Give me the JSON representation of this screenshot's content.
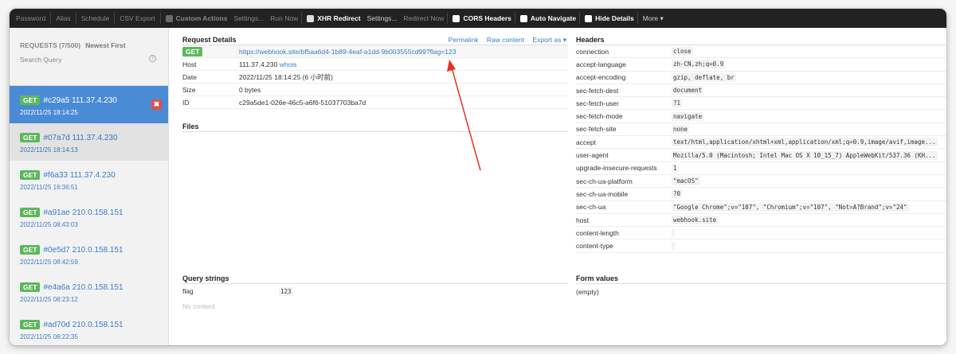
{
  "toolbar": {
    "password": "Password",
    "alias": "Alias",
    "schedule": "Schedule",
    "csv_export": "CSV Export",
    "custom_actions": "Custom Actions",
    "custom_settings": "Settings...",
    "run_now": "Run Now",
    "xhr_redirect": "XHR Redirect",
    "xhr_settings": "Settings...",
    "redirect_now": "Redirect Now",
    "cors_headers": "CORS Headers",
    "auto_navigate": "Auto Navigate",
    "hide_details": "Hide Details",
    "more": "More ▾"
  },
  "sidebar": {
    "requests_label": "REQUESTS (7/500)",
    "sort_label": "Newest First",
    "search_placeholder": "Search Query",
    "items": [
      {
        "method": "GET",
        "id": "#c29a5",
        "ip": "111.37.4.230",
        "date": "2022/11/25 18:14:25"
      },
      {
        "method": "GET",
        "id": "#07a7d",
        "ip": "111.37.4.230",
        "date": "2022/11/25 18:14:13"
      },
      {
        "method": "GET",
        "id": "#f6a33",
        "ip": "111.37.4.230",
        "date": "2022/11/25 16:36:51"
      },
      {
        "method": "GET",
        "id": "#a91ae",
        "ip": "210.0.158.151",
        "date": "2022/11/25 08:43:03"
      },
      {
        "method": "GET",
        "id": "#0e5d7",
        "ip": "210.0.158.151",
        "date": "2022/11/25 08:42:59"
      },
      {
        "method": "GET",
        "id": "#e4a6a",
        "ip": "210.0.158.151",
        "date": "2022/11/25 08:23:12"
      },
      {
        "method": "GET",
        "id": "#ad70d",
        "ip": "210.0.158.151",
        "date": "2022/11/25 08:22:35"
      }
    ]
  },
  "request_details": {
    "title": "Request Details",
    "permalink": "Permalink",
    "raw_content": "Raw content",
    "export_as": "Export as ▾",
    "method": "GET",
    "url": "https://webhook.site/bf5aa6d4-1b89-4eaf-a1dd-9b003555cd99?flag=123",
    "host_label": "Host",
    "host_value": "111.37.4.230",
    "whois": "whois",
    "date_label": "Date",
    "date_value": "2022/11/25 18:14:25 (6 小时前)",
    "size_label": "Size",
    "size_value": "0 bytes",
    "id_label": "ID",
    "id_value": "c29a5de1-026e-46c5-a6f6-51037703ba7d"
  },
  "files": {
    "title": "Files"
  },
  "query_strings": {
    "title": "Query strings",
    "rows": [
      {
        "key": "flag",
        "value": "123"
      }
    ],
    "no_content": "No content"
  },
  "headers": {
    "title": "Headers",
    "rows": [
      {
        "key": "connection",
        "value": "close"
      },
      {
        "key": "accept-language",
        "value": "zh-CN,zh;q=0.9"
      },
      {
        "key": "accept-encoding",
        "value": "gzip, deflate, br"
      },
      {
        "key": "sec-fetch-dest",
        "value": "document"
      },
      {
        "key": "sec-fetch-user",
        "value": "?1"
      },
      {
        "key": "sec-fetch-mode",
        "value": "navigate"
      },
      {
        "key": "sec-fetch-site",
        "value": "none"
      },
      {
        "key": "accept",
        "value": "text/html,application/xhtml+xml,application/xml;q=0.9,image/avif,image..."
      },
      {
        "key": "user-agent",
        "value": "Mozilla/5.0 (Macintosh; Intel Mac OS X 10_15_7) AppleWebKit/537.36 (KH..."
      },
      {
        "key": "upgrade-insecure-requests",
        "value": "1"
      },
      {
        "key": "sec-ch-ua-platform",
        "value": "\"macOS\""
      },
      {
        "key": "sec-ch-ua-mobile",
        "value": "?0"
      },
      {
        "key": "sec-ch-ua",
        "value": "\"Google Chrome\";v=\"107\", \"Chromium\";v=\"107\", \"Not=A?Brand\";v=\"24\""
      },
      {
        "key": "host",
        "value": "webhook.site"
      },
      {
        "key": "content-length",
        "value": ""
      },
      {
        "key": "content-type",
        "value": ""
      }
    ]
  },
  "form_values": {
    "title": "Form values",
    "empty": "(empty)"
  },
  "colors": {
    "accent": "#4a8bd6",
    "badge": "#5cb85c",
    "delete": "#d9534f",
    "annotation": "#e8321c"
  }
}
